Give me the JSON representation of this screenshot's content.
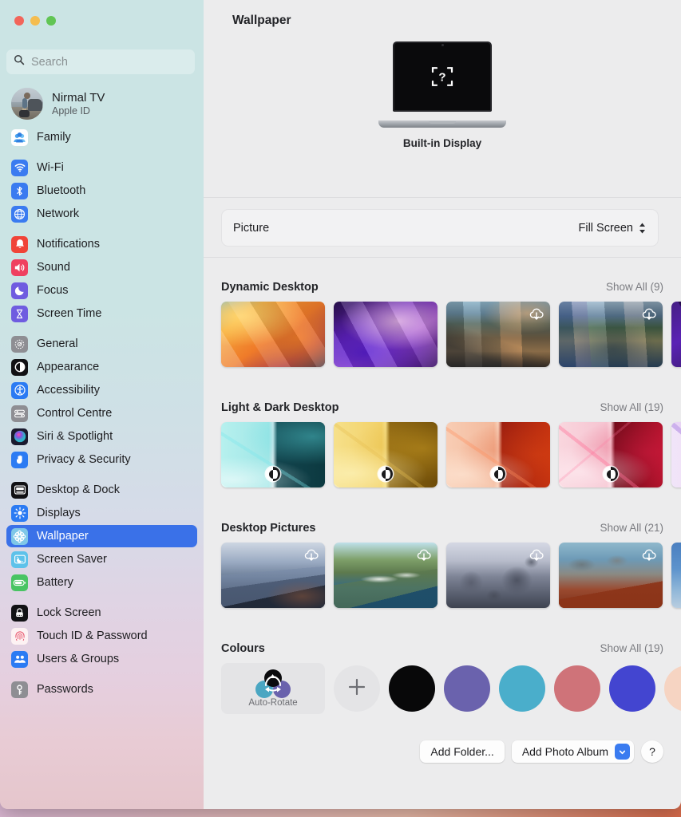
{
  "window": {
    "traffic_lights": [
      {
        "name": "close",
        "color": "#f2655a"
      },
      {
        "name": "minimize",
        "color": "#f5bd4f"
      },
      {
        "name": "zoom",
        "color": "#61c554"
      }
    ]
  },
  "sidebar": {
    "search": {
      "placeholder": "Search",
      "value": "",
      "icon": "search-icon"
    },
    "account": {
      "name": "Nirmal TV",
      "subtitle": "Apple ID",
      "avatar": "user-avatar"
    },
    "groups": [
      {
        "items": [
          {
            "label": "Family",
            "icon": "family-icon",
            "color": "#ffffff",
            "selected": false
          }
        ]
      },
      {
        "items": [
          {
            "label": "Wi-Fi",
            "icon": "wifi-icon",
            "color": "#3a7bf0",
            "selected": false
          },
          {
            "label": "Bluetooth",
            "icon": "bluetooth-icon",
            "color": "#3a7bf0",
            "selected": false
          },
          {
            "label": "Network",
            "icon": "network-globe-icon",
            "color": "#3a7bf0",
            "selected": false
          }
        ]
      },
      {
        "items": [
          {
            "label": "Notifications",
            "icon": "notifications-bell-icon",
            "color": "#f04438",
            "selected": false
          },
          {
            "label": "Sound",
            "icon": "sound-speaker-icon",
            "color": "#ef4060",
            "selected": false
          },
          {
            "label": "Focus",
            "icon": "focus-moon-icon",
            "color": "#6f5ce0",
            "selected": false
          },
          {
            "label": "Screen Time",
            "icon": "screen-time-hourglass-icon",
            "color": "#6f5ce0",
            "selected": false
          }
        ]
      },
      {
        "items": [
          {
            "label": "General",
            "icon": "general-gear-icon",
            "color": "#8e8e93",
            "selected": false
          },
          {
            "label": "Appearance",
            "icon": "appearance-contrast-icon",
            "color": "#111114",
            "selected": false
          },
          {
            "label": "Accessibility",
            "icon": "accessibility-person-icon",
            "color": "#2b7bf3",
            "selected": false
          },
          {
            "label": "Control Centre",
            "icon": "control-centre-sliders-icon",
            "color": "#8e8e93",
            "selected": false
          },
          {
            "label": "Siri & Spotlight",
            "icon": "siri-orb-icon",
            "color": "#1a1a2e",
            "selected": false
          },
          {
            "label": "Privacy & Security",
            "icon": "privacy-hand-icon",
            "color": "#2b7bf3",
            "selected": false
          }
        ]
      },
      {
        "items": [
          {
            "label": "Desktop & Dock",
            "icon": "desktop-dock-icon",
            "color": "#111114",
            "selected": false
          },
          {
            "label": "Displays",
            "icon": "displays-brightness-icon",
            "color": "#2b7bf3",
            "selected": false
          },
          {
            "label": "Wallpaper",
            "icon": "wallpaper-flower-icon",
            "color": "#7fc7e8",
            "selected": true
          },
          {
            "label": "Screen Saver",
            "icon": "screen-saver-icon",
            "color": "#5ec2ea",
            "selected": false
          },
          {
            "label": "Battery",
            "icon": "battery-icon",
            "color": "#49c463",
            "selected": false
          }
        ]
      },
      {
        "items": [
          {
            "label": "Lock Screen",
            "icon": "lock-screen-icon",
            "color": "#111114",
            "selected": false
          },
          {
            "label": "Touch ID & Password",
            "icon": "touch-id-fingerprint-icon",
            "color": "#fdf2f3",
            "selected": false
          },
          {
            "label": "Users & Groups",
            "icon": "users-groups-icon",
            "color": "#2b7bf3",
            "selected": false
          }
        ]
      },
      {
        "items": [
          {
            "label": "Passwords",
            "icon": "passwords-key-icon",
            "color": "#8e8e93",
            "selected": false
          }
        ]
      }
    ]
  },
  "main": {
    "title": "Wallpaper",
    "display": {
      "label": "Built-in Display",
      "icon": "macbook-icon",
      "screen_icon": "unknown-wallpaper-placeholder-icon"
    },
    "picture": {
      "label": "Picture",
      "value": "Fill Screen",
      "icon": "stepper-updown-icon"
    },
    "sections": [
      {
        "id": "dynamic-desktop",
        "title": "Dynamic Desktop",
        "show_all": "Show All (9)",
        "thumbs": [
          {
            "name": "ventura-orange",
            "badge": null
          },
          {
            "name": "monterey-purple",
            "badge": null
          },
          {
            "name": "big-sur-coast",
            "badge": "cloud-download-icon"
          },
          {
            "name": "catalina-island",
            "badge": "cloud-download-icon"
          },
          {
            "name": "mojave-night",
            "badge": null
          }
        ]
      },
      {
        "id": "light-dark-desktop",
        "title": "Light & Dark Desktop",
        "show_all": "Show All (19)",
        "thumbs": [
          {
            "name": "teal-split",
            "badge": "appearance-icon"
          },
          {
            "name": "yellow-split",
            "badge": "appearance-icon"
          },
          {
            "name": "orange-split",
            "badge": "appearance-icon"
          },
          {
            "name": "pink-split",
            "badge": "appearance-icon"
          },
          {
            "name": "lavender-split",
            "badge": null
          }
        ]
      },
      {
        "id": "desktop-pictures",
        "title": "Desktop Pictures",
        "show_all": "Show All (21)",
        "thumbs": [
          {
            "name": "blue-mountains",
            "badge": "cloud-download-icon"
          },
          {
            "name": "green-coastline",
            "badge": "cloud-download-icon"
          },
          {
            "name": "sea-rocks",
            "badge": "cloud-download-icon"
          },
          {
            "name": "red-cliffs",
            "badge": "cloud-download-icon"
          },
          {
            "name": "blue-shore",
            "badge": null
          }
        ]
      },
      {
        "id": "colours",
        "title": "Colours",
        "show_all": "Show All (19)",
        "auto_rotate": {
          "label": "Auto-Rotate",
          "icon": "auto-rotate-icon"
        },
        "add": {
          "icon": "plus-icon"
        },
        "swatches": [
          {
            "name": "black",
            "color": "#080809"
          },
          {
            "name": "purple",
            "color": "#6a62ad"
          },
          {
            "name": "teal",
            "color": "#4aaecb"
          },
          {
            "name": "rose",
            "color": "#cf7379"
          },
          {
            "name": "blue",
            "color": "#4345d0"
          },
          {
            "name": "peach",
            "color": "#f6d4c2"
          }
        ]
      }
    ],
    "footer": {
      "add_folder": "Add Folder...",
      "add_photo_album": "Add Photo Album",
      "popup_icon": "chevron-down-icon",
      "help": "?"
    }
  }
}
